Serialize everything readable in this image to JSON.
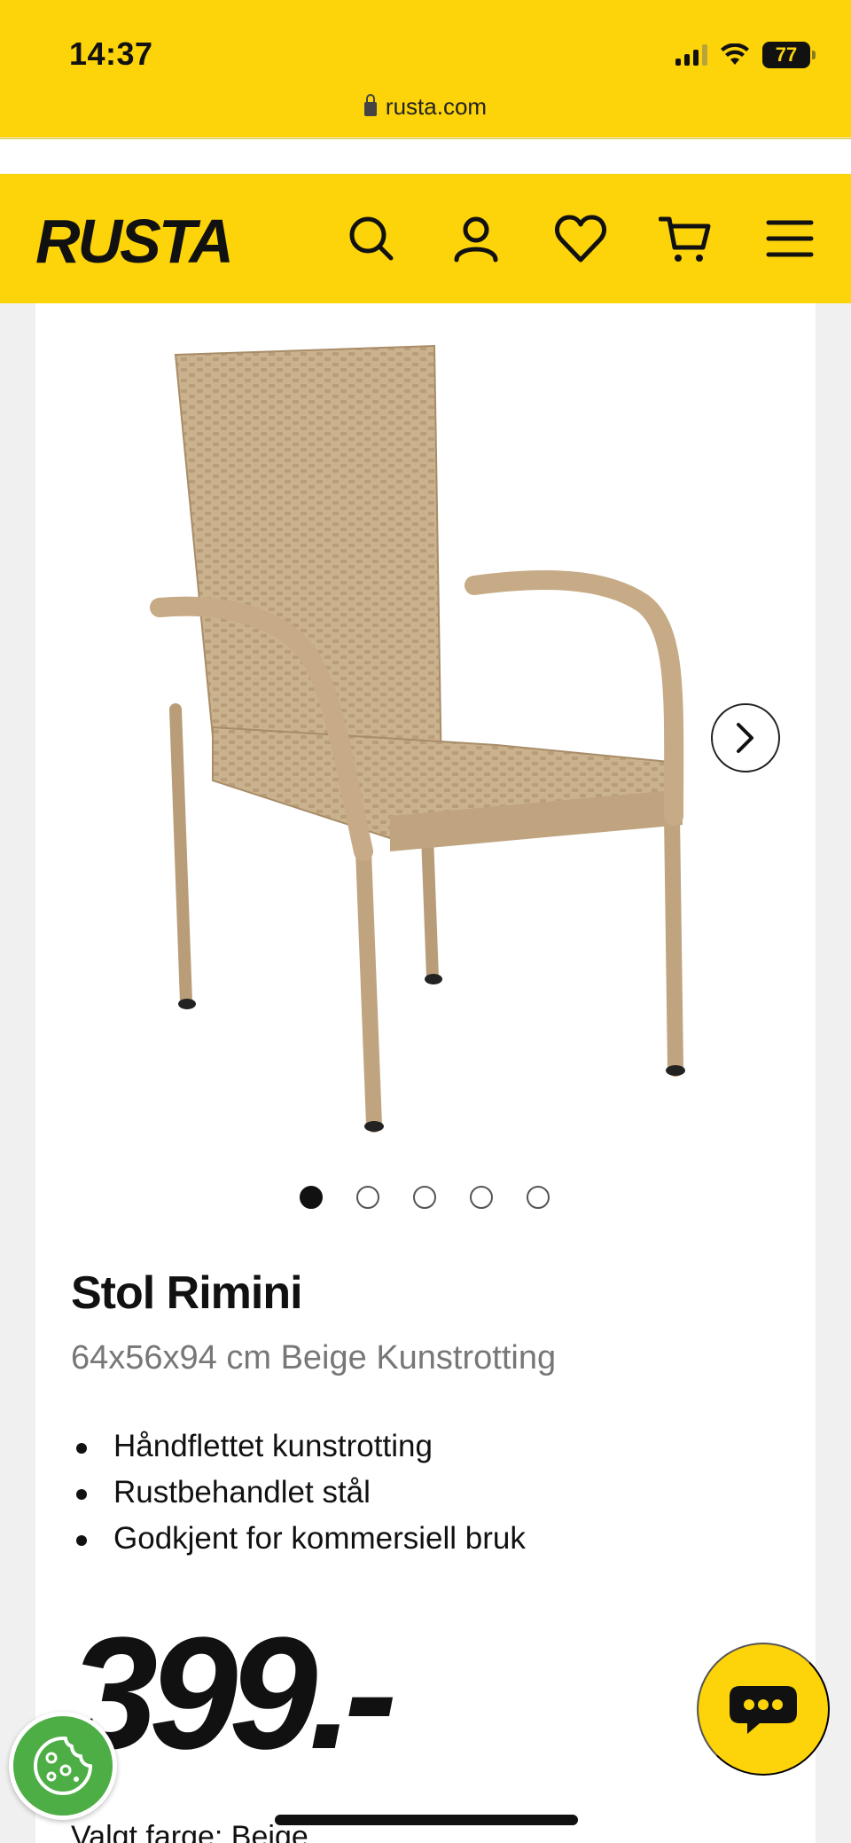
{
  "status_bar": {
    "time": "14:37",
    "battery": "77"
  },
  "browser": {
    "url": "rusta.com"
  },
  "header": {
    "logo_text": "RUSTA",
    "icons": [
      "search-icon",
      "account-icon",
      "heart-icon",
      "cart-icon",
      "menu-icon"
    ]
  },
  "product": {
    "title": "Stol Rimini",
    "subtitle": "64x56x94 cm Beige Kunstrotting",
    "features": [
      "Håndflettet kunstrotting",
      "Rustbehandlet stål",
      "Godkjent for kommersiell bruk"
    ],
    "price": "399.-",
    "color_label": "Valgt farge: Beige"
  },
  "gallery": {
    "total_images": 5,
    "active_index": 0
  },
  "colors": {
    "brand_yellow": "#fdd30a",
    "cookie_green": "#4cae45",
    "chair_beige": "#c9b08c"
  }
}
